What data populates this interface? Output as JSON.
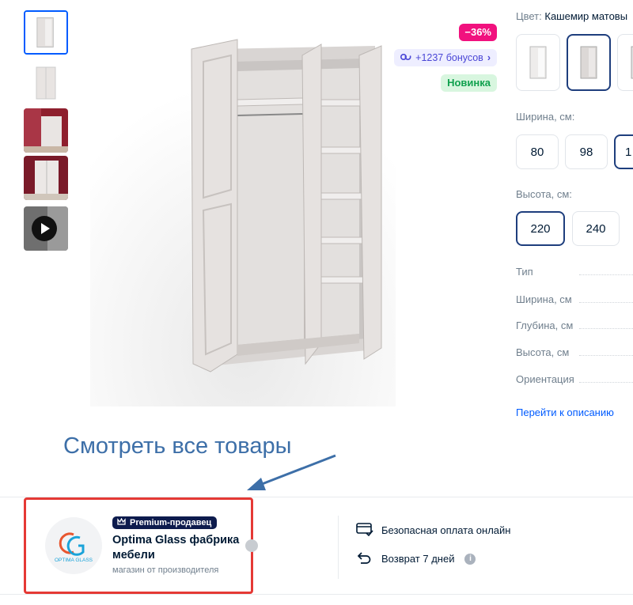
{
  "product": {
    "badges": {
      "sale": "−36%",
      "bonus": "+1237 бонусов",
      "new": "Новинка"
    },
    "color_label": "Цвет:",
    "color_value": "Кашемир матовы",
    "width_label": "Ширина, см:",
    "widths": [
      "80",
      "98",
      "1"
    ],
    "height_label": "Высота, см:",
    "heights": [
      "220",
      "240"
    ],
    "selected_width_index": 2,
    "selected_height_index": 0,
    "specs": [
      "Тип",
      "Ширина, см",
      "Глубина, см",
      "Высота, см",
      "Ориентация"
    ],
    "goto_description": "Перейти к описанию"
  },
  "annotation": {
    "text": "Смотреть все товары"
  },
  "seller": {
    "premium_label": "Premium-продавец",
    "name": "Optima Glass фабрика мебели",
    "subtitle": "магазин от производителя",
    "logo_text": "OPTIMA GLASS"
  },
  "benefits": {
    "secure_payment": "Безопасная оплата онлайн",
    "return": "Возврат 7 дней"
  },
  "colors": {
    "accent": "#005bff",
    "sale": "#f1117e",
    "annotation": "#3d6fa8",
    "highlight_box": "#e53935",
    "premium": "#0d1b4d"
  }
}
